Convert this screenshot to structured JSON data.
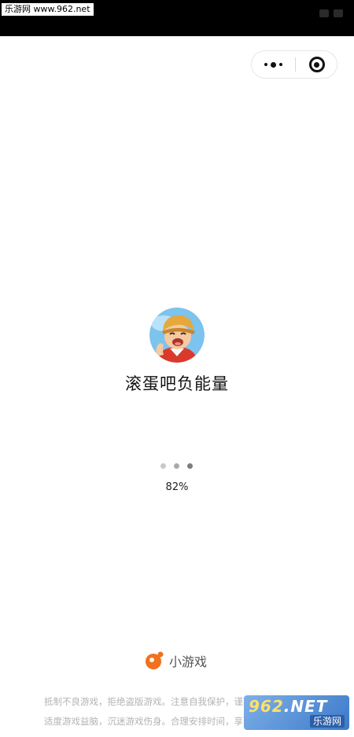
{
  "status_bar": {
    "watermark_text": "乐游网 www.962.net"
  },
  "capsule": {
    "more_icon": "more-dots-icon",
    "close_icon": "target-circle-icon"
  },
  "game": {
    "title": "滚蛋吧负能量",
    "icon": "cartoon-boy-avatar"
  },
  "loading": {
    "progress_text": "82%",
    "progress": 0.82,
    "dot_colors": [
      "#c8c8c8",
      "#a9a9a9",
      "#7d7d7d"
    ]
  },
  "brand": {
    "name": "小游戏",
    "accent": "#f0711e"
  },
  "notice": {
    "line1": "抵制不良游戏，拒绝盗版游戏。注意自我保护，谨防受骗上当。",
    "line2": "适度游戏益脑，沉迷游戏伤身。合理安排时间，享受健康生活。"
  },
  "watermark": {
    "number": "962",
    "suffix": ".NET",
    "name": "乐游网"
  }
}
